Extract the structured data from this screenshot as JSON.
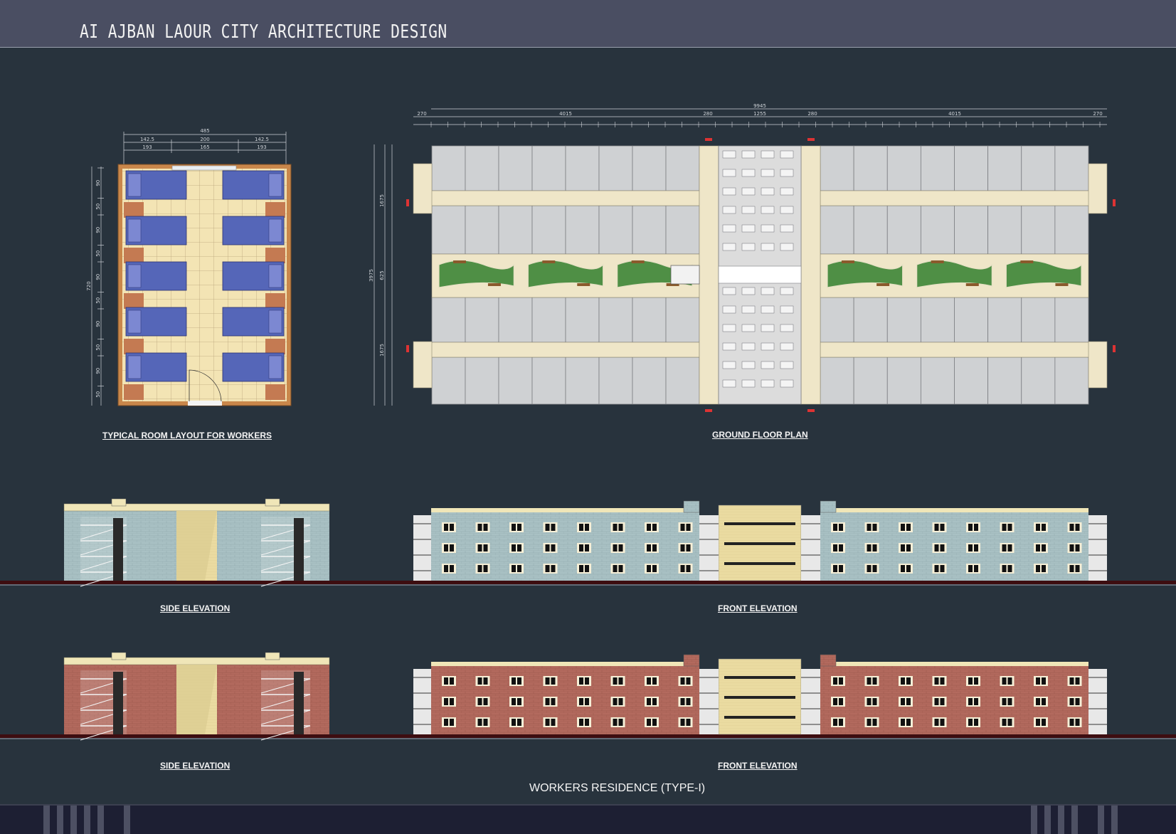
{
  "header": {
    "title": "AI AJBAN LAOUR CITY ARCHITECTURE DESIGN"
  },
  "captions": {
    "room_layout": "TYPICAL ROOM LAYOUT FOR WORKERS",
    "ground_floor": "GROUND FLOOR PLAN",
    "side_elevation_1": "SIDE ELEVATION",
    "front_elevation_1": "FRONT ELEVATION",
    "side_elevation_2": "SIDE ELEVATION",
    "front_elevation_2": "FRONT ELEVATION"
  },
  "subtitle": "WORKERS RESIDENCE (TYPE-I)",
  "room_dims": {
    "top_total": "485",
    "top_row2": [
      "142.5",
      "200",
      "142.5"
    ],
    "top_row3": [
      "193",
      "165",
      "193"
    ],
    "left_total": "720",
    "left_segments": [
      "90",
      "50",
      "90",
      "50",
      "90",
      "50",
      "90",
      "50",
      "90",
      "50"
    ]
  },
  "plan_dims": {
    "total": "9945",
    "row2": [
      "270",
      "4015",
      "280",
      "1255",
      "280",
      "4015",
      "270"
    ],
    "left_total": "3975",
    "left_segments": [
      "1675",
      "625",
      "1675"
    ]
  },
  "colors": {
    "background": "#28333d",
    "header": "#4a4e62",
    "bed": "#5566b8",
    "floor_tile": "#f3e4b4",
    "wardrobe": "#c47a52",
    "room_gray": "#cfd1d3",
    "corridor": "#efe6c8",
    "garden": "#4f8f45",
    "facade_blue": "#a9c1c4",
    "facade_brick": "#b36a5e",
    "stair_core": "#eadba1"
  }
}
